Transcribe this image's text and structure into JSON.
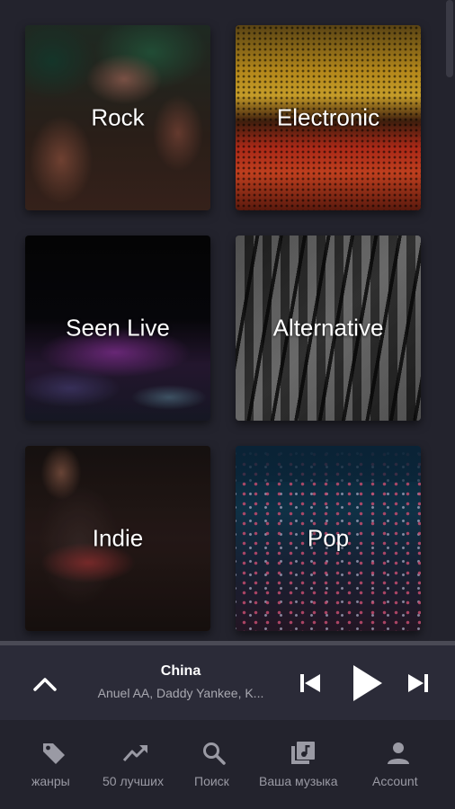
{
  "genres": [
    {
      "label": "Rock"
    },
    {
      "label": "Electronic"
    },
    {
      "label": "Seen Live"
    },
    {
      "label": "Alternative"
    },
    {
      "label": "Indie"
    },
    {
      "label": "Pop"
    }
  ],
  "player": {
    "title": "China",
    "artist": "Anuel AA, Daddy Yankee, K..."
  },
  "nav": {
    "items": [
      {
        "label": "жанры",
        "icon": "tag-icon"
      },
      {
        "label": "50 лучших",
        "icon": "trending-icon"
      },
      {
        "label": "Поиск",
        "icon": "search-icon"
      },
      {
        "label": "Ваша музыка",
        "icon": "library-music-icon"
      },
      {
        "label": "Account",
        "icon": "account-icon"
      }
    ]
  },
  "colors": {
    "background": "#23232d",
    "player_bg": "#2b2b38",
    "text_muted": "#9a9aa4"
  }
}
